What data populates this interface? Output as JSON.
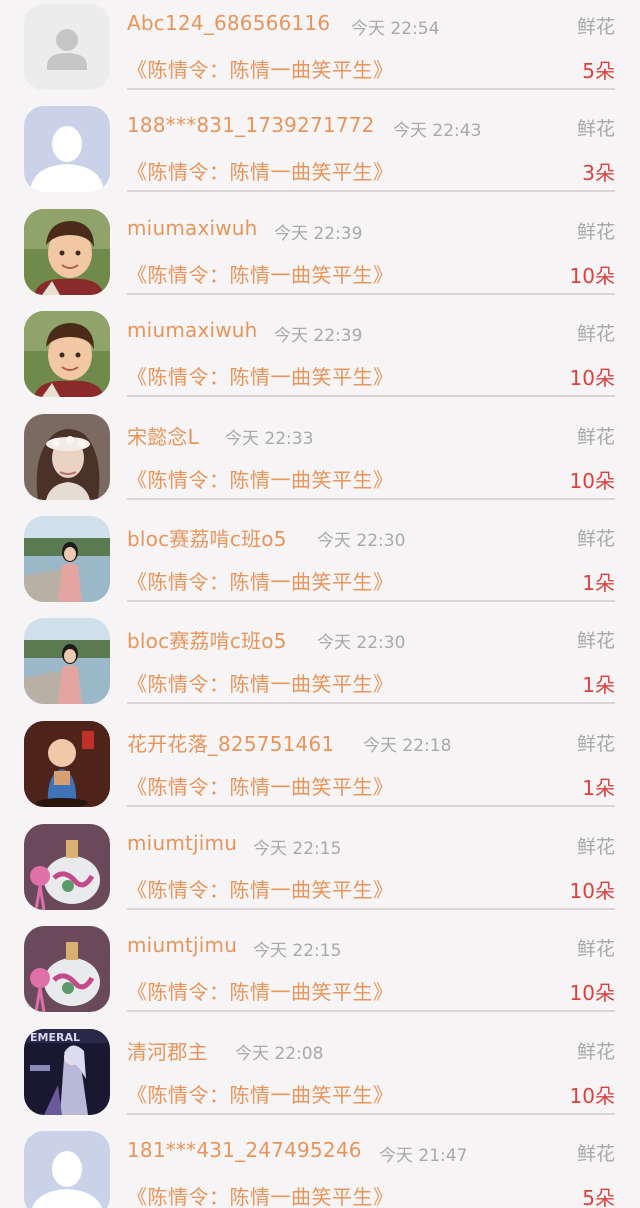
{
  "gift_label": "鲜花",
  "items": [
    {
      "name": "Abc124_686566116",
      "time": "今天 22:54",
      "gift": "鲜花",
      "work": "《陈情令：陈情一曲笑平生》",
      "count": "5朵",
      "avatar": "default-gray-avatar"
    },
    {
      "name": "188***831_1739271772",
      "time": "今天 22:43",
      "gift": "鲜花",
      "work": "《陈情令：陈情一曲笑平生》",
      "count": "3朵",
      "avatar": "default-blue-avatar"
    },
    {
      "name": "miumaxiwuh",
      "time": "今天 22:39",
      "gift": "鲜花",
      "work": "《陈情令：陈情一曲笑平生》",
      "count": "10朵",
      "avatar": "boy-photo-avatar"
    },
    {
      "name": "miumaxiwuh",
      "time": "今天 22:39",
      "gift": "鲜花",
      "work": "《陈情令：陈情一曲笑平生》",
      "count": "10朵",
      "avatar": "boy-photo-avatar"
    },
    {
      "name": "宋懿念L",
      "time": "今天 22:33",
      "gift": "鲜花",
      "work": "《陈情令：陈情一曲笑平生》",
      "count": "10朵",
      "avatar": "girl-flower-crown-avatar"
    },
    {
      "name": "bloc赛荔啃c班o5",
      "time": "今天 22:30",
      "gift": "鲜花",
      "work": "《陈情令：陈情一曲笑平生》",
      "count": "1朵",
      "avatar": "girl-lakeside-avatar"
    },
    {
      "name": "bloc赛荔啃c班o5",
      "time": "今天 22:30",
      "gift": "鲜花",
      "work": "《陈情令：陈情一曲笑平生》",
      "count": "1朵",
      "avatar": "girl-lakeside-avatar"
    },
    {
      "name": "花开花落_825751461",
      "time": "今天 22:18",
      "gift": "鲜花",
      "work": "《陈情令：陈情一曲笑平生》",
      "count": "1朵",
      "avatar": "monk-figurine-avatar"
    },
    {
      "name": "miumtjimu",
      "time": "今天 22:15",
      "gift": "鲜花",
      "work": "《陈情令：陈情一曲笑平生》",
      "count": "10朵",
      "avatar": "perfume-bottle-avatar"
    },
    {
      "name": "miumtjimu",
      "time": "今天 22:15",
      "gift": "鲜花",
      "work": "《陈情令：陈情一曲笑平生》",
      "count": "10朵",
      "avatar": "perfume-bottle-avatar"
    },
    {
      "name": "清河郡主",
      "time": "今天 22:08",
      "gift": "鲜花",
      "work": "《陈情令：陈情一曲笑平生》",
      "count": "10朵",
      "avatar": "anime-character-avatar"
    },
    {
      "name": "181***431_247495246",
      "time": "今天 21:47",
      "gift": "鲜花",
      "work": "《陈情令：陈情一曲笑平生》",
      "count": "5朵",
      "avatar": "default-blue-avatar"
    }
  ]
}
